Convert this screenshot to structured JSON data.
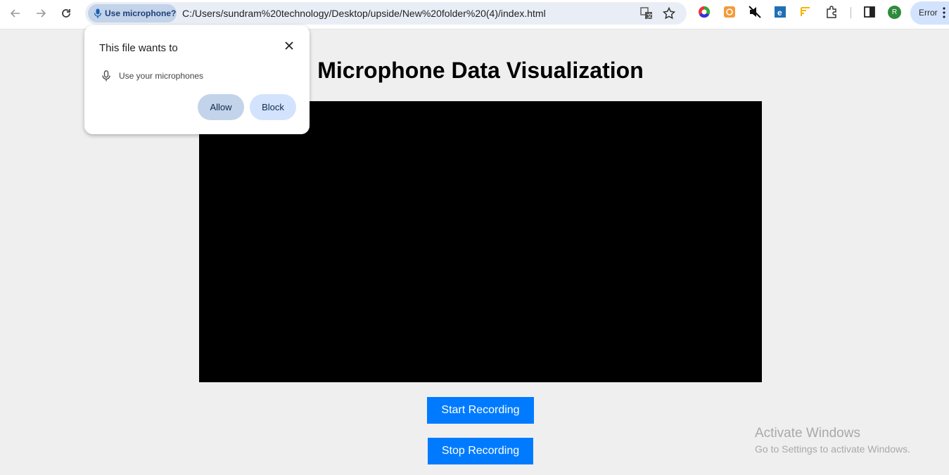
{
  "browser": {
    "permission_chip": "Use microphone?",
    "url": "C:/Users/sundram%20technology/Desktop/upside/New%20folder%20(4)/index.html",
    "profile_initial": "R",
    "error_label": "Error"
  },
  "page": {
    "title": "Microphone Data Visualization",
    "start_button": "Start Recording",
    "stop_button": "Stop Recording"
  },
  "popup": {
    "title": "This file wants to",
    "permission": "Use your microphones",
    "allow_label": "Allow",
    "block_label": "Block"
  },
  "watermark": {
    "line1": "Activate Windows",
    "line2": "Go to Settings to activate Windows."
  },
  "colors": {
    "accent_button": "#007bff",
    "page_bg": "#efefef"
  }
}
